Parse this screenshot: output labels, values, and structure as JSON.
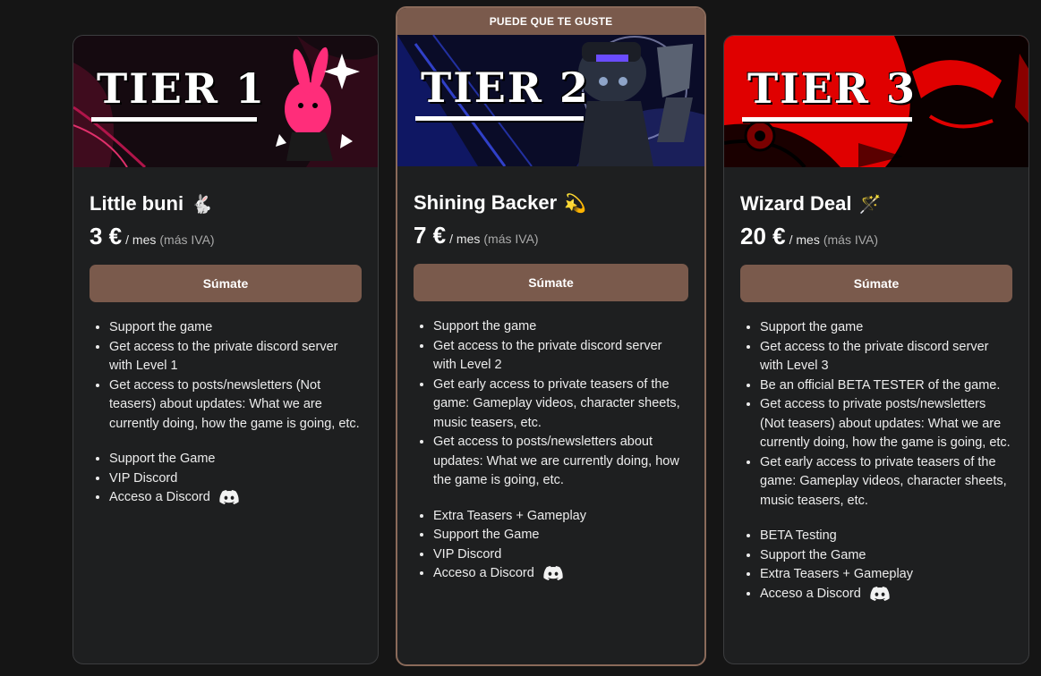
{
  "colors": {
    "background": "#151515",
    "card": "#1e1f20",
    "accent": "#7a5a4c"
  },
  "tiers": [
    {
      "banner_title": "TIER 1",
      "name": "Little buni",
      "emoji": "🐇",
      "price": "3 €",
      "per": "/ mes",
      "iva": "(más IVA)",
      "button": "Súmate",
      "benefits": [
        "Support the game",
        "Get access to the private discord server with Level 1",
        "Get access to posts/newsletters (Not teasers) about updates: What we are currently doing, how the game is going, etc."
      ],
      "extras": [
        "Support the Game",
        "VIP Discord",
        "Acceso a Discord"
      ]
    },
    {
      "ribbon": "PUEDE QUE TE GUSTE",
      "banner_title": "TIER 2",
      "name": "Shining Backer",
      "emoji": "💫",
      "price": "7 €",
      "per": "/ mes",
      "iva": "(más IVA)",
      "button": "Súmate",
      "benefits": [
        "Support the game",
        "Get access to the private discord server with Level 2",
        "Get early access to private teasers of the game: Gameplay videos, character sheets, music teasers, etc.",
        "Get access to posts/newsletters about updates: What we are currently doing, how the game is going, etc."
      ],
      "extras": [
        "Extra Teasers + Gameplay",
        "Support the Game",
        "VIP Discord",
        "Acceso a Discord"
      ]
    },
    {
      "banner_title": "TIER 3",
      "name": "Wizard Deal",
      "emoji": "🪄",
      "price": "20 €",
      "per": "/ mes",
      "iva": "(más IVA)",
      "button": "Súmate",
      "benefits": [
        "Support the game",
        "Get access to the private discord server with Level 3",
        "Be an official BETA TESTER of the game.",
        "Get access to private posts/newsletters (Not teasers) about updates: What we are currently doing, how the game is going, etc.",
        "Get early access to private teasers of the game: Gameplay videos, character sheets, music teasers, etc."
      ],
      "extras": [
        "BETA Testing",
        "Support the Game",
        "Extra Teasers + Gameplay",
        "Acceso a Discord"
      ]
    }
  ]
}
